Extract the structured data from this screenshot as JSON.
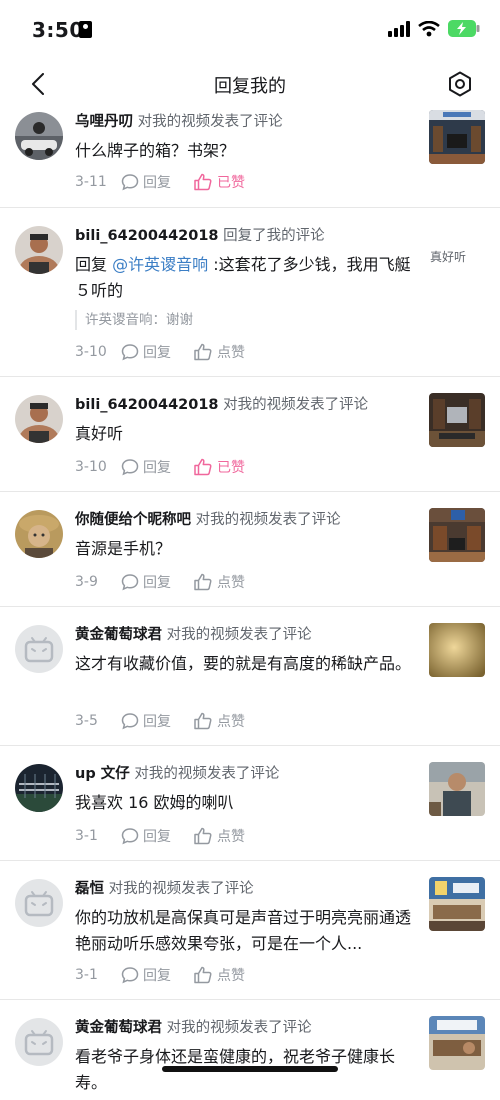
{
  "status_bar": {
    "time": "3:50"
  },
  "nav": {
    "title": "回复我的"
  },
  "items": [
    {
      "username": "乌哩丹叨",
      "action": "对我的视频发表了评论",
      "text": "什么牌子的箱？书架？",
      "date": "3-11",
      "reply_label": "回复",
      "like_label": "已赞",
      "liked": true
    },
    {
      "username": "bili_64200442018",
      "action": "回复了我的评论",
      "reply_prefix": "回复 ",
      "mention": "@许英谡音响",
      "text": " :这套花了多少钱，我用飞艇５听的",
      "quote": "许英谡音响：谢谢",
      "side_text": "真好听",
      "date": "3-10",
      "reply_label": "回复",
      "like_label": "点赞",
      "liked": false
    },
    {
      "username": "bili_64200442018",
      "action": "对我的视频发表了评论",
      "text": "真好听",
      "date": "3-10",
      "reply_label": "回复",
      "like_label": "已赞",
      "liked": true
    },
    {
      "username": "你随便给个昵称吧",
      "action": "对我的视频发表了评论",
      "text": "音源是手机？",
      "date": "3-9",
      "reply_label": "回复",
      "like_label": "点赞",
      "liked": false
    },
    {
      "username": "黄金葡萄球君",
      "action": "对我的视频发表了评论",
      "text": "这才有收藏价值，要的就是有高度的稀缺产品。",
      "date": "3-5",
      "reply_label": "回复",
      "like_label": "点赞",
      "liked": false
    },
    {
      "username": "up 文仔",
      "action": "对我的视频发表了评论",
      "text": "我喜欢 16 欧姆的喇叭",
      "date": "3-1",
      "reply_label": "回复",
      "like_label": "点赞",
      "liked": false
    },
    {
      "username": "磊恒",
      "action": "对我的视频发表了评论",
      "text": "你的功放机是高保真可是声音过于明亮亮丽通透艳丽动听乐感效果夸张，可是在一个人...",
      "date": "3-1",
      "reply_label": "回复",
      "like_label": "点赞",
      "liked": false
    },
    {
      "username": "黄金葡萄球君",
      "action": "对我的视频发表了评论",
      "text": "看老爷子身体还是蛮健康的，祝老爷子健康长寿。",
      "date": "",
      "reply_label": "",
      "like_label": "",
      "liked": false
    }
  ],
  "colors": {
    "accent": "#f0679c",
    "link": "#3b7ec5",
    "text": "#18191c",
    "secondary": "#9499a0"
  }
}
